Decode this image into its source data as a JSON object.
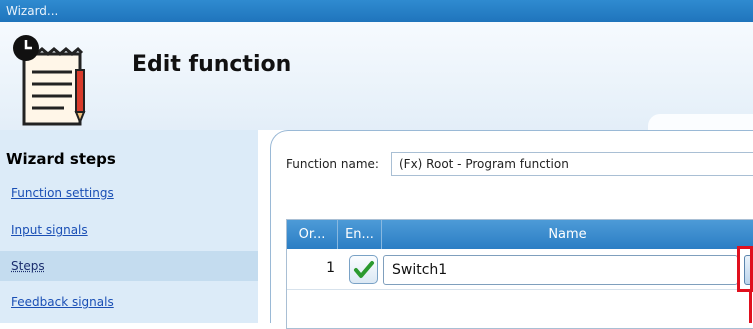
{
  "window": {
    "title": "Wizard..."
  },
  "header": {
    "title": "Edit function",
    "icon": "notepad-pencil-clock-icon"
  },
  "sidebar": {
    "title": "Wizard steps",
    "items": [
      {
        "label": "Function settings"
      },
      {
        "label": "Input signals"
      },
      {
        "label": "Steps",
        "active": true
      },
      {
        "label": "Feedback signals"
      }
    ]
  },
  "main": {
    "function_name_label": "Function name:",
    "function_name_value": "(Fx) Root - Program function",
    "grid": {
      "columns": [
        "Or...",
        "En...",
        "Name"
      ],
      "rows": [
        {
          "order": "1",
          "enabled": true,
          "name": "Switch1",
          "action_label": "..."
        }
      ]
    }
  },
  "colors": {
    "titlebar": "#2079c1",
    "header_row": "#3f8fd0",
    "highlight": "#e0101e"
  }
}
